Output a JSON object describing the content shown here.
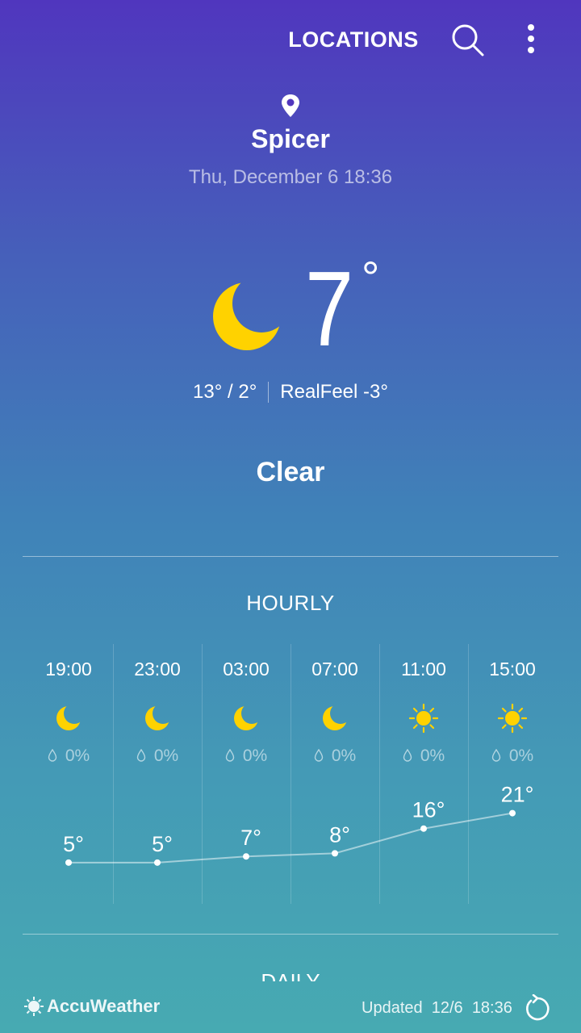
{
  "topbar": {
    "locations_label": "LOCATIONS",
    "search_icon": "search-icon",
    "more_icon": "more-vert-icon"
  },
  "header": {
    "city": "Spicer",
    "datetime": "Thu, December 6 18:36",
    "pin_icon": "location-pin-icon"
  },
  "current": {
    "icon": "moon-icon",
    "temp": "7",
    "degree": "°",
    "hi_lo": "13° / 2°",
    "realfeel": "RealFeel -3°",
    "condition": "Clear",
    "icon_color": "#ffd200"
  },
  "hourly": {
    "title": "HOURLY",
    "items": [
      {
        "time": "19:00",
        "icon": "moon-icon",
        "rain": "0%",
        "temp": "5°",
        "temp_value": 5
      },
      {
        "time": "23:00",
        "icon": "moon-icon",
        "rain": "0%",
        "temp": "5°",
        "temp_value": 5
      },
      {
        "time": "03:00",
        "icon": "moon-icon",
        "rain": "0%",
        "temp": "7°",
        "temp_value": 7
      },
      {
        "time": "07:00",
        "icon": "moon-icon",
        "rain": "0%",
        "temp": "8°",
        "temp_value": 8
      },
      {
        "time": "11:00",
        "icon": "sun-icon",
        "rain": "0%",
        "temp": "16°",
        "temp_value": 16
      },
      {
        "time": "15:00",
        "icon": "sun-icon",
        "rain": "0%",
        "temp": "21°",
        "temp_value": 21
      }
    ]
  },
  "daily": {
    "title": "DAILY"
  },
  "footer": {
    "brand": "AccuWeather",
    "updated_label": "Updated",
    "updated_date": "12/6",
    "updated_time": "18:36",
    "refresh_icon": "refresh-icon"
  }
}
